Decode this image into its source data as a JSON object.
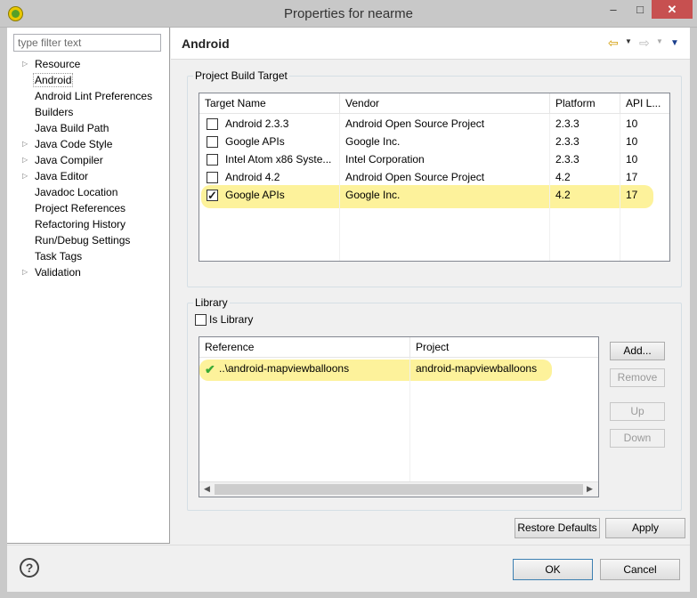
{
  "window": {
    "title": "Properties for nearme",
    "minimize": "–",
    "maximize": "□",
    "close": "✕",
    "app_icon": "eclipse-icon"
  },
  "sidebar": {
    "filter_placeholder": "type filter text",
    "items": [
      {
        "label": "Resource",
        "expandable": true
      },
      {
        "label": "Android",
        "expandable": false,
        "selected": true
      },
      {
        "label": "Android Lint Preferences",
        "expandable": false
      },
      {
        "label": "Builders",
        "expandable": false
      },
      {
        "label": "Java Build Path",
        "expandable": false
      },
      {
        "label": "Java Code Style",
        "expandable": true
      },
      {
        "label": "Java Compiler",
        "expandable": true
      },
      {
        "label": "Java Editor",
        "expandable": true
      },
      {
        "label": "Javadoc Location",
        "expandable": false
      },
      {
        "label": "Project References",
        "expandable": false
      },
      {
        "label": "Refactoring History",
        "expandable": false
      },
      {
        "label": "Run/Debug Settings",
        "expandable": false
      },
      {
        "label": "Task Tags",
        "expandable": false
      },
      {
        "label": "Validation",
        "expandable": true
      }
    ]
  },
  "page": {
    "title": "Android",
    "nav_icons": [
      "back-arrow-icon",
      "forward-arrow-icon",
      "view-menu-icon"
    ]
  },
  "build_target": {
    "group_label": "Project Build Target",
    "columns": [
      "Target Name",
      "Vendor",
      "Platform",
      "API L..."
    ],
    "rows": [
      {
        "name": "Android 2.3.3",
        "vendor": "Android Open Source Project",
        "platform": "2.3.3",
        "api": "10",
        "checked": false
      },
      {
        "name": "Google APIs",
        "vendor": "Google Inc.",
        "platform": "2.3.3",
        "api": "10",
        "checked": false
      },
      {
        "name": "Intel Atom x86 Syste...",
        "vendor": "Intel Corporation",
        "platform": "2.3.3",
        "api": "10",
        "checked": false
      },
      {
        "name": "Android 4.2",
        "vendor": "Android Open Source Project",
        "platform": "4.2",
        "api": "17",
        "checked": false
      },
      {
        "name": "Google APIs",
        "vendor": "Google Inc.",
        "platform": "4.2",
        "api": "17",
        "checked": true,
        "highlighted": true
      }
    ]
  },
  "library": {
    "group_label": "Library",
    "is_library_label": "Is Library",
    "is_library_checked": false,
    "columns": [
      "Reference",
      "Project"
    ],
    "rows": [
      {
        "reference": "..\\android-mapviewballoons",
        "project": "android-mapviewballoons",
        "status": "ok",
        "highlighted": true
      }
    ],
    "buttons": {
      "add": "Add...",
      "remove": "Remove",
      "up": "Up",
      "down": "Down"
    }
  },
  "footer": {
    "restore_defaults": "Restore Defaults",
    "apply": "Apply",
    "ok": "OK",
    "cancel": "Cancel",
    "help": "?"
  }
}
